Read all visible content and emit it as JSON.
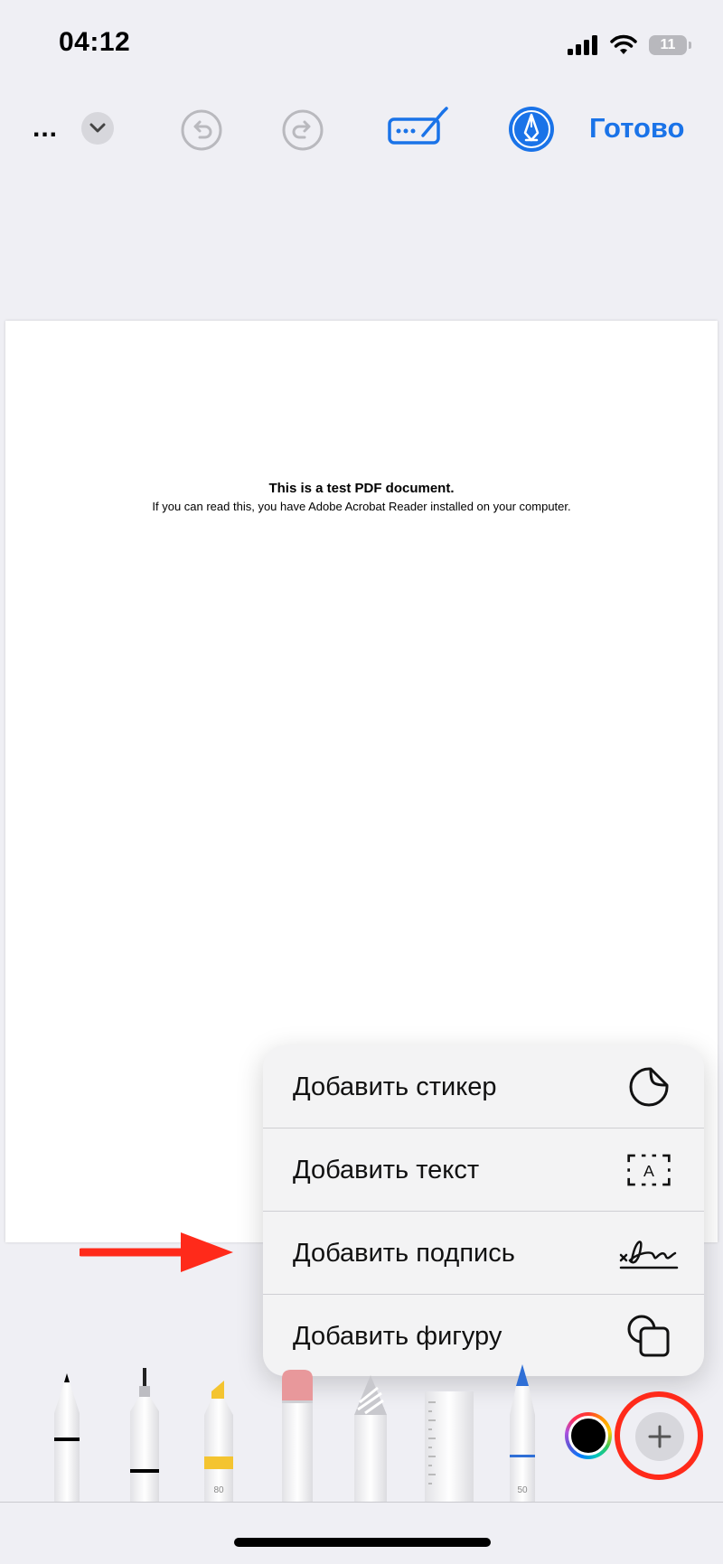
{
  "status_bar": {
    "time": "04:12",
    "battery": "11"
  },
  "toolbar": {
    "more_label": "...",
    "done_label": "Готово"
  },
  "document": {
    "title": "This is a test PDF document.",
    "subtitle": "If you can read this, you have Adobe Acrobat Reader installed on your computer."
  },
  "menu": {
    "items": [
      {
        "label": "Добавить стикер",
        "icon": "sticker-icon"
      },
      {
        "label": "Добавить текст",
        "icon": "text-box-icon"
      },
      {
        "label": "Добавить подпись",
        "icon": "signature-icon"
      },
      {
        "label": "Добавить фигуру",
        "icon": "shapes-icon"
      }
    ]
  },
  "tools": {
    "marker_width": "80",
    "pencil_width": "50",
    "selected_color": "#000000"
  },
  "colors": {
    "accent": "#1a73e8",
    "annotation": "#ff2a1a"
  }
}
